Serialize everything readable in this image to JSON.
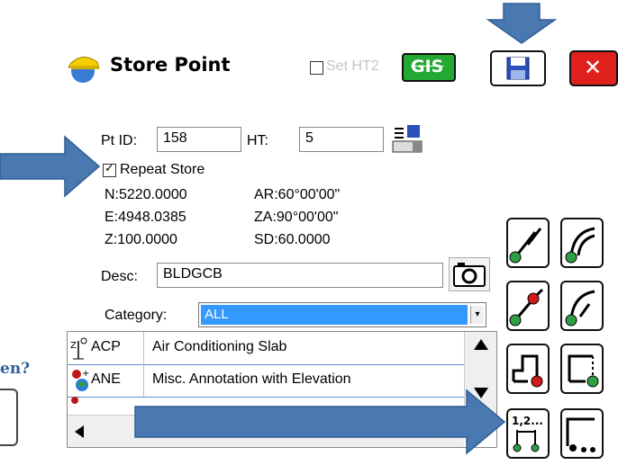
{
  "window": {
    "title": "Store Point",
    "set_ht2_label": "Set HT2",
    "gis_label": "GIS",
    "close_label": "✕"
  },
  "form": {
    "pt_id_label": "Pt ID:",
    "pt_id_value": "158",
    "ht_label": "HT:",
    "ht_value": "5",
    "repeat_store_label": "Repeat Store",
    "repeat_store_checked": true,
    "n_text": "N:5220.0000",
    "e_text": "E:4948.0385",
    "z_text": "Z:100.0000",
    "ar_text": "AR:60°00'00\"",
    "za_text": "ZA:90°00'00\"",
    "sd_text": "SD:60.0000",
    "desc_label": "Desc:",
    "desc_value": "BLDGCB",
    "category_label": "Category:",
    "category_value": "ALL"
  },
  "codes": [
    {
      "code": "ACP",
      "description": "Air Conditioning Slab"
    },
    {
      "code": "ANE",
      "description": "Misc. Annotation with Elevation"
    }
  ],
  "outside_text": "en?",
  "colors": {
    "close_red": "#e0201c",
    "gis_green": "#22a833",
    "select_blue": "#3399ff",
    "arrow_blue": "#4a78b0"
  },
  "icons": [
    "app-logo-icon",
    "save-icon",
    "settings-save-icon",
    "camera-icon",
    "scroll-up-icon",
    "scroll-down-icon",
    "scroll-left-icon",
    "scroll-right-icon"
  ]
}
